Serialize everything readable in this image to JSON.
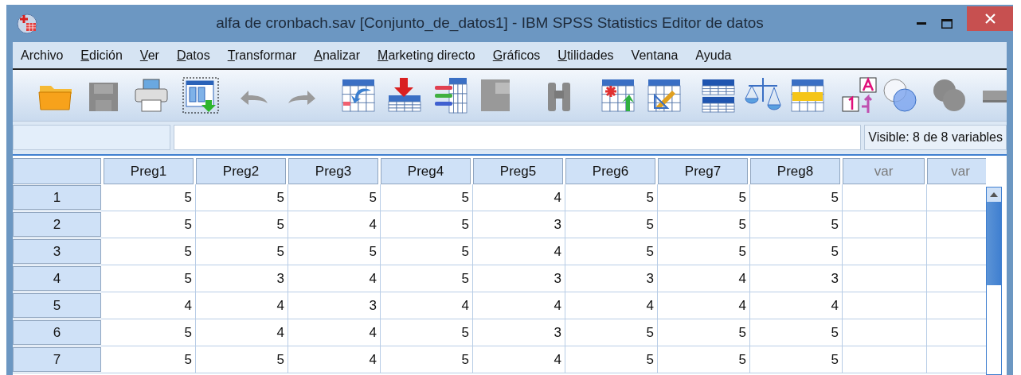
{
  "window": {
    "title": "alfa de cronbach.sav [Conjunto_de_datos1] - IBM SPSS Statistics Editor de datos"
  },
  "menu": [
    {
      "label": "Archivo",
      "underline_first": false
    },
    {
      "label": "Edición",
      "underline_first": true
    },
    {
      "label": "Ver",
      "underline_first": true
    },
    {
      "label": "Datos",
      "underline_first": true
    },
    {
      "label": "Transformar",
      "underline_first": true
    },
    {
      "label": "Analizar",
      "underline_first": true
    },
    {
      "label": "Marketing directo",
      "underline_first": true
    },
    {
      "label": "Gráficos",
      "underline_first": true
    },
    {
      "label": "Utilidades",
      "underline_first": true
    },
    {
      "label": "Ventana",
      "underline_first": false
    },
    {
      "label": "Ayuda",
      "underline_first": false
    }
  ],
  "visible_count": "Visible: 8 de 8 variables",
  "table": {
    "columns": [
      {
        "label": "Preg1",
        "kind": "variable"
      },
      {
        "label": "Preg2",
        "kind": "variable"
      },
      {
        "label": "Preg3",
        "kind": "variable"
      },
      {
        "label": "Preg4",
        "kind": "variable"
      },
      {
        "label": "Preg5",
        "kind": "variable"
      },
      {
        "label": "Preg6",
        "kind": "variable"
      },
      {
        "label": "Preg7",
        "kind": "variable"
      },
      {
        "label": "Preg8",
        "kind": "variable"
      },
      {
        "label": "var",
        "kind": "empty"
      },
      {
        "label": "var",
        "kind": "empty"
      }
    ],
    "rows": [
      {
        "label": "1",
        "cells": [
          "5",
          "5",
          "5",
          "5",
          "4",
          "5",
          "5",
          "5"
        ]
      },
      {
        "label": "2",
        "cells": [
          "5",
          "5",
          "4",
          "5",
          "3",
          "5",
          "5",
          "5"
        ]
      },
      {
        "label": "3",
        "cells": [
          "5",
          "5",
          "5",
          "5",
          "4",
          "5",
          "5",
          "5"
        ]
      },
      {
        "label": "4",
        "cells": [
          "5",
          "3",
          "4",
          "5",
          "3",
          "3",
          "4",
          "3"
        ]
      },
      {
        "label": "5",
        "cells": [
          "4",
          "4",
          "3",
          "4",
          "4",
          "4",
          "4",
          "4"
        ]
      },
      {
        "label": "6",
        "cells": [
          "5",
          "4",
          "4",
          "5",
          "3",
          "5",
          "5",
          "5"
        ]
      },
      {
        "label": "7",
        "cells": [
          "5",
          "5",
          "4",
          "5",
          "4",
          "5",
          "5",
          "5"
        ]
      }
    ]
  }
}
